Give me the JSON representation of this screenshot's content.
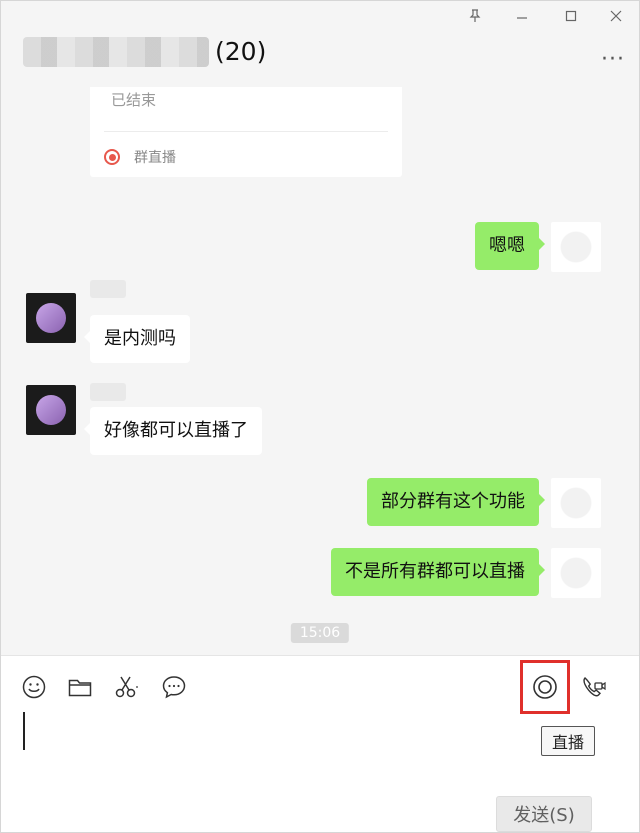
{
  "window": {
    "title_count": "(20)",
    "controls": [
      "pin-icon",
      "minimize-icon",
      "maximize-icon",
      "close-icon"
    ],
    "more_label": "···"
  },
  "live_card": {
    "status": "已结束",
    "label": "群直播",
    "accent": "#e7584c"
  },
  "messages": [
    {
      "side": "mine",
      "text": "嗯嗯"
    },
    {
      "side": "theirs",
      "text": "是内测吗"
    },
    {
      "side": "theirs",
      "text": "好像都可以直播了"
    },
    {
      "side": "mine",
      "text": "部分群有这个功能"
    },
    {
      "side": "mine",
      "text": "不是所有群都可以直播"
    }
  ],
  "timestamp": "15:06",
  "composer": {
    "tools": [
      "emoji-icon",
      "folder-icon",
      "scissors-icon",
      "chat-bubble-icon",
      "live-stream-icon",
      "video-call-icon"
    ],
    "tooltip": "直播",
    "send_label": "发送(S)"
  },
  "colors": {
    "my_bubble": "#95ec69",
    "their_bubble": "#ffffff",
    "background": "#f5f5f5",
    "highlight_box": "#e0302b"
  }
}
